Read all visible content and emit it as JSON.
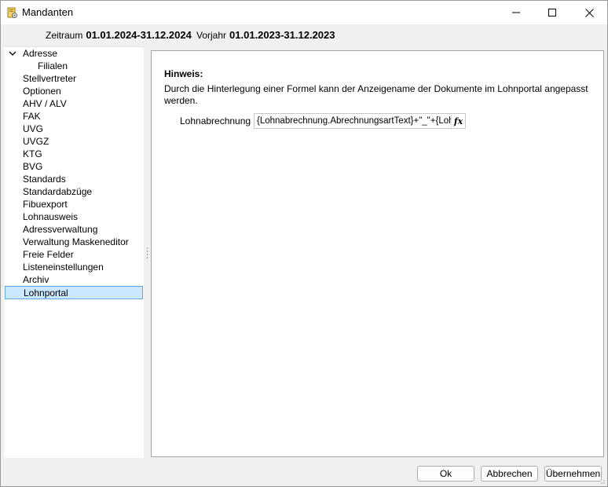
{
  "window": {
    "title": "Mandanten",
    "icons": {
      "app": "app-icon",
      "minimize": "minimize-icon",
      "maximize": "maximize-icon",
      "close": "close-icon"
    }
  },
  "period": {
    "current_label": "Zeitraum",
    "current_value": "01.01.2024-31.12.2024",
    "previous_label": "Vorjahr",
    "previous_value": "01.01.2023-31.12.2023"
  },
  "tree": {
    "items": [
      {
        "label": "Adresse",
        "expanded": true
      },
      {
        "label": "Filialen",
        "child": true
      },
      {
        "label": "Stellvertreter"
      },
      {
        "label": "Optionen"
      },
      {
        "label": "AHV / ALV"
      },
      {
        "label": "FAK"
      },
      {
        "label": "UVG"
      },
      {
        "label": "UVGZ"
      },
      {
        "label": "KTG"
      },
      {
        "label": "BVG"
      },
      {
        "label": "Standards"
      },
      {
        "label": "Standardabzüge"
      },
      {
        "label": "Fibuexport"
      },
      {
        "label": "Lohnausweis"
      },
      {
        "label": "Adressverwaltung"
      },
      {
        "label": "Verwaltung Maskeneditor"
      },
      {
        "label": "Freie Felder"
      },
      {
        "label": "Listeneinstellungen"
      },
      {
        "label": "Archiv"
      },
      {
        "label": "Lohnportal",
        "selected": true
      }
    ]
  },
  "content": {
    "hint_title": "Hinweis:",
    "hint_text": "Durch die Hinterlegung einer Formel kann der Anzeigename der Dokumente im Lohnportal angepasst werden.",
    "field_label": "Lohnabrechnung",
    "field_value": "{Lohnabrechnung.AbrechnungsartText}+\"_\"+{Lohnabrechnung",
    "formula_button": "fx"
  },
  "buttons": {
    "ok": "Ok",
    "cancel": "Abbrechen",
    "apply": "Übernehmen"
  }
}
